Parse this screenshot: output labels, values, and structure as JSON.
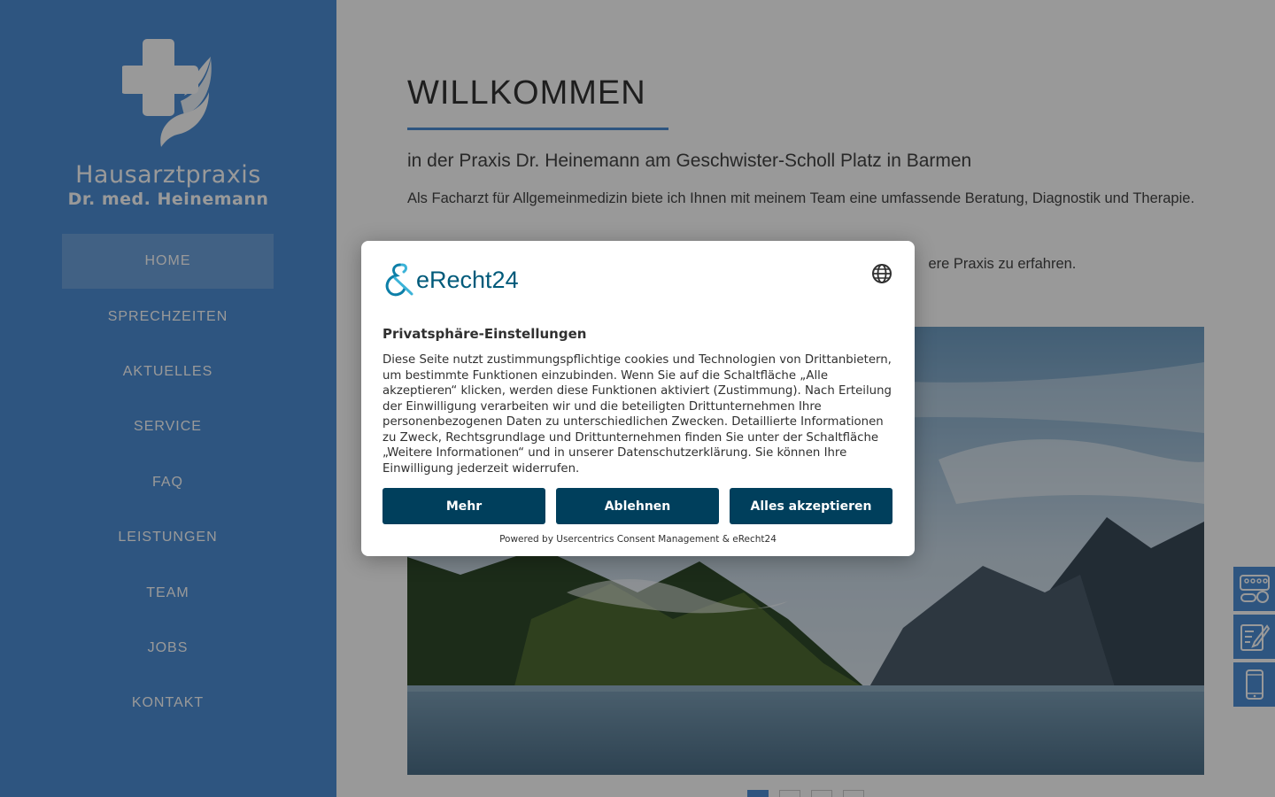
{
  "sidebar": {
    "logo_line1": "Hausarztpraxis",
    "logo_line2": "Dr. med. Heinemann",
    "nav": [
      {
        "label": "HOME",
        "active": true
      },
      {
        "label": "SPRECHZEITEN"
      },
      {
        "label": "AKTUELLES"
      },
      {
        "label": "SERVICE"
      },
      {
        "label": "FAQ"
      },
      {
        "label": "LEISTUNGEN"
      },
      {
        "label": "TEAM"
      },
      {
        "label": "JOBS"
      },
      {
        "label": "KONTAKT"
      }
    ]
  },
  "main": {
    "title": "WILLKOMMEN",
    "subtitle": "in der Praxis Dr. Heinemann am Geschwister-Scholl Platz in Barmen",
    "intro": "Als Facharzt für Allgemeinmedizin biete ich Ihnen mit meinem Team eine umfassende Beratung, Diagnostik und Therapie.",
    "intro2_visible_part": "ere Praxis zu erfahren.",
    "slider_pages": 4,
    "slider_active": 1
  },
  "quick_icons": [
    "pills-icon",
    "prescription-edit-icon",
    "smartphone-icon"
  ],
  "consent": {
    "brand": "eRecht24",
    "heading": "Privatsphäre-Einstellungen",
    "body": "Diese Seite nutzt zustimmungspflichtige cookies und Technologien von Drittanbietern, um bestimmte Funktionen einzubinden. Wenn Sie auf die Schaltfläche „Alle akzeptieren“ klicken, werden diese Funktionen aktiviert (Zustimmung). Nach Erteilung der Einwilligung verarbeiten wir und die beteiligten Drittunternehmen Ihre personenbezogenen Daten zu unterschiedlichen Zwecken. Detaillierte Informationen zu Zweck, Rechtsgrundlage und Drittunternehmen finden Sie unter der Schaltfläche „Weitere Informationen“ und in unserer Datenschutzerklärung. Sie können Ihre Einwilligung jederzeit widerrufen.",
    "btn_more": "Mehr",
    "btn_decline": "Ablehnen",
    "btn_accept": "Alles akzeptieren",
    "powered_by": "Powered by Usercentrics Consent Management & eRecht24"
  },
  "colors": {
    "sidebar": "#4d8ed6",
    "accent": "#4d8ed6",
    "consent_button": "#003f5c",
    "consent_brand": "#005a7a"
  }
}
